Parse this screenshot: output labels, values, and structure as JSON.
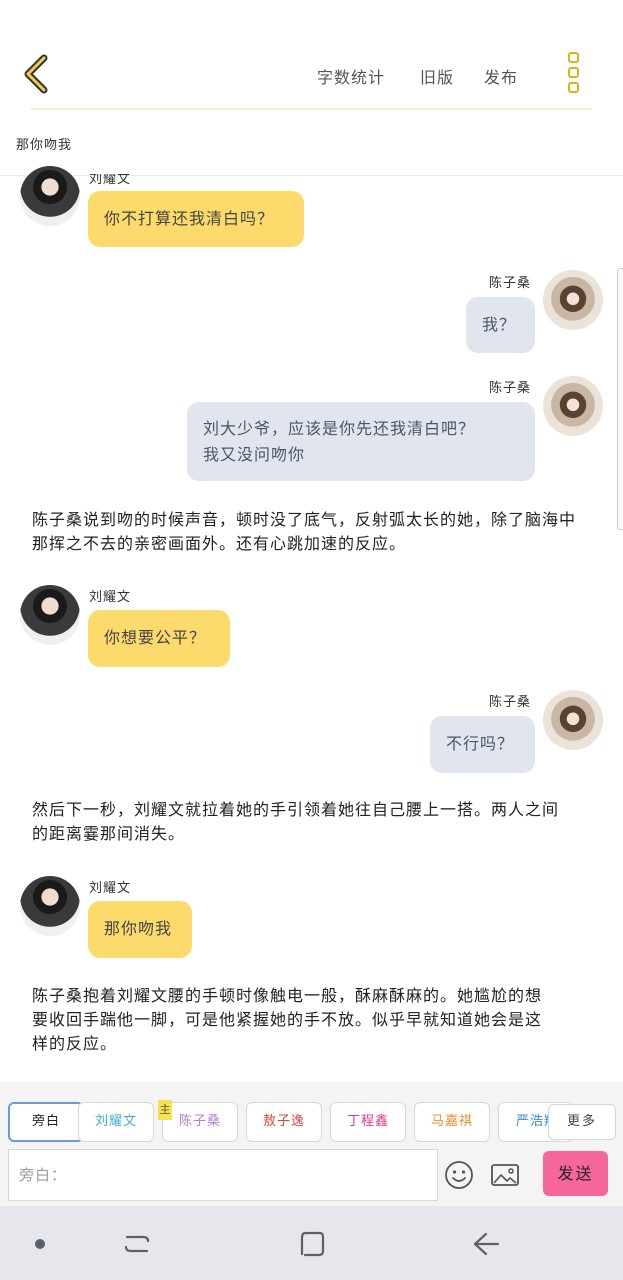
{
  "header": {
    "word_count_label": "字数统计",
    "old_version_label": "旧版",
    "publish_label": "发布"
  },
  "chapter_title": "那你吻我",
  "messages": [
    {
      "speaker": "刘耀文",
      "text": "你不打算还我清白吗？"
    },
    {
      "speaker": "陈子桑",
      "text": "我？"
    },
    {
      "speaker": "陈子桑",
      "line1": "刘大少爷，应该是你先还我清白吧？",
      "line2": "我又没问吻你"
    },
    {
      "narration": "陈子桑说到吻的时候声音，顿时没了底气，反射弧太长的她，除了脑海中那挥之不去的亲密画面外。还有心跳加速的反应。"
    },
    {
      "speaker": "刘耀文",
      "text": "你想要公平？"
    },
    {
      "speaker": "陈子桑",
      "text": "不行吗？"
    },
    {
      "narration": "然后下一秒，刘耀文就拉着她的手引领着她往自己腰上一搭。两人之间的距离霎那间消失。"
    },
    {
      "speaker": "刘耀文",
      "text": "那你吻我"
    },
    {
      "narration": "陈子桑抱着刘耀文腰的手顿时像触电一般，酥麻酥麻的。她尴尬的想要收回手踹他一脚，可是他紧握她的手不放。似乎早就知道她会是这样的反应。"
    }
  ],
  "characters": [
    {
      "name": "旁白",
      "color": "#444444"
    },
    {
      "name": "刘耀文",
      "color": "#3ab3c9"
    },
    {
      "name": "陈子桑",
      "color": "#b77ed8"
    },
    {
      "name": "敖子逸",
      "color": "#e0443d"
    },
    {
      "name": "丁程鑫",
      "color": "#e23a8a"
    },
    {
      "name": "马嘉祺",
      "color": "#f08a2e"
    },
    {
      "name": "严浩翔",
      "color": "#3a8ad6"
    }
  ],
  "main_tag": "主",
  "more_label": "更多",
  "input": {
    "placeholder": "旁白："
  },
  "send_label": "发送"
}
